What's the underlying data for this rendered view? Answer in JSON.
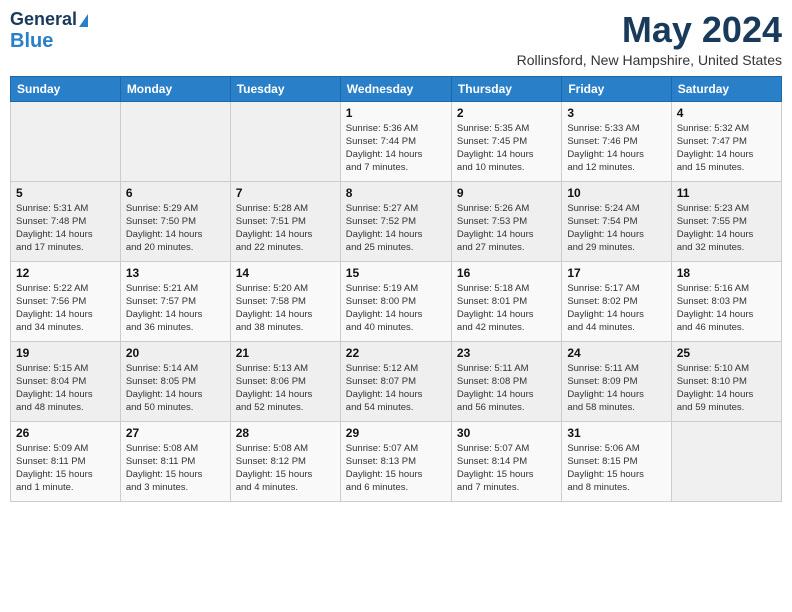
{
  "header": {
    "logo_line1": "General",
    "logo_line2": "Blue",
    "month": "May 2024",
    "location": "Rollinsford, New Hampshire, United States"
  },
  "days_of_week": [
    "Sunday",
    "Monday",
    "Tuesday",
    "Wednesday",
    "Thursday",
    "Friday",
    "Saturday"
  ],
  "weeks": [
    [
      {
        "day": "",
        "info": ""
      },
      {
        "day": "",
        "info": ""
      },
      {
        "day": "",
        "info": ""
      },
      {
        "day": "1",
        "info": "Sunrise: 5:36 AM\nSunset: 7:44 PM\nDaylight: 14 hours\nand 7 minutes."
      },
      {
        "day": "2",
        "info": "Sunrise: 5:35 AM\nSunset: 7:45 PM\nDaylight: 14 hours\nand 10 minutes."
      },
      {
        "day": "3",
        "info": "Sunrise: 5:33 AM\nSunset: 7:46 PM\nDaylight: 14 hours\nand 12 minutes."
      },
      {
        "day": "4",
        "info": "Sunrise: 5:32 AM\nSunset: 7:47 PM\nDaylight: 14 hours\nand 15 minutes."
      }
    ],
    [
      {
        "day": "5",
        "info": "Sunrise: 5:31 AM\nSunset: 7:48 PM\nDaylight: 14 hours\nand 17 minutes."
      },
      {
        "day": "6",
        "info": "Sunrise: 5:29 AM\nSunset: 7:50 PM\nDaylight: 14 hours\nand 20 minutes."
      },
      {
        "day": "7",
        "info": "Sunrise: 5:28 AM\nSunset: 7:51 PM\nDaylight: 14 hours\nand 22 minutes."
      },
      {
        "day": "8",
        "info": "Sunrise: 5:27 AM\nSunset: 7:52 PM\nDaylight: 14 hours\nand 25 minutes."
      },
      {
        "day": "9",
        "info": "Sunrise: 5:26 AM\nSunset: 7:53 PM\nDaylight: 14 hours\nand 27 minutes."
      },
      {
        "day": "10",
        "info": "Sunrise: 5:24 AM\nSunset: 7:54 PM\nDaylight: 14 hours\nand 29 minutes."
      },
      {
        "day": "11",
        "info": "Sunrise: 5:23 AM\nSunset: 7:55 PM\nDaylight: 14 hours\nand 32 minutes."
      }
    ],
    [
      {
        "day": "12",
        "info": "Sunrise: 5:22 AM\nSunset: 7:56 PM\nDaylight: 14 hours\nand 34 minutes."
      },
      {
        "day": "13",
        "info": "Sunrise: 5:21 AM\nSunset: 7:57 PM\nDaylight: 14 hours\nand 36 minutes."
      },
      {
        "day": "14",
        "info": "Sunrise: 5:20 AM\nSunset: 7:58 PM\nDaylight: 14 hours\nand 38 minutes."
      },
      {
        "day": "15",
        "info": "Sunrise: 5:19 AM\nSunset: 8:00 PM\nDaylight: 14 hours\nand 40 minutes."
      },
      {
        "day": "16",
        "info": "Sunrise: 5:18 AM\nSunset: 8:01 PM\nDaylight: 14 hours\nand 42 minutes."
      },
      {
        "day": "17",
        "info": "Sunrise: 5:17 AM\nSunset: 8:02 PM\nDaylight: 14 hours\nand 44 minutes."
      },
      {
        "day": "18",
        "info": "Sunrise: 5:16 AM\nSunset: 8:03 PM\nDaylight: 14 hours\nand 46 minutes."
      }
    ],
    [
      {
        "day": "19",
        "info": "Sunrise: 5:15 AM\nSunset: 8:04 PM\nDaylight: 14 hours\nand 48 minutes."
      },
      {
        "day": "20",
        "info": "Sunrise: 5:14 AM\nSunset: 8:05 PM\nDaylight: 14 hours\nand 50 minutes."
      },
      {
        "day": "21",
        "info": "Sunrise: 5:13 AM\nSunset: 8:06 PM\nDaylight: 14 hours\nand 52 minutes."
      },
      {
        "day": "22",
        "info": "Sunrise: 5:12 AM\nSunset: 8:07 PM\nDaylight: 14 hours\nand 54 minutes."
      },
      {
        "day": "23",
        "info": "Sunrise: 5:11 AM\nSunset: 8:08 PM\nDaylight: 14 hours\nand 56 minutes."
      },
      {
        "day": "24",
        "info": "Sunrise: 5:11 AM\nSunset: 8:09 PM\nDaylight: 14 hours\nand 58 minutes."
      },
      {
        "day": "25",
        "info": "Sunrise: 5:10 AM\nSunset: 8:10 PM\nDaylight: 14 hours\nand 59 minutes."
      }
    ],
    [
      {
        "day": "26",
        "info": "Sunrise: 5:09 AM\nSunset: 8:11 PM\nDaylight: 15 hours\nand 1 minute."
      },
      {
        "day": "27",
        "info": "Sunrise: 5:08 AM\nSunset: 8:11 PM\nDaylight: 15 hours\nand 3 minutes."
      },
      {
        "day": "28",
        "info": "Sunrise: 5:08 AM\nSunset: 8:12 PM\nDaylight: 15 hours\nand 4 minutes."
      },
      {
        "day": "29",
        "info": "Sunrise: 5:07 AM\nSunset: 8:13 PM\nDaylight: 15 hours\nand 6 minutes."
      },
      {
        "day": "30",
        "info": "Sunrise: 5:07 AM\nSunset: 8:14 PM\nDaylight: 15 hours\nand 7 minutes."
      },
      {
        "day": "31",
        "info": "Sunrise: 5:06 AM\nSunset: 8:15 PM\nDaylight: 15 hours\nand 8 minutes."
      },
      {
        "day": "",
        "info": ""
      }
    ]
  ]
}
